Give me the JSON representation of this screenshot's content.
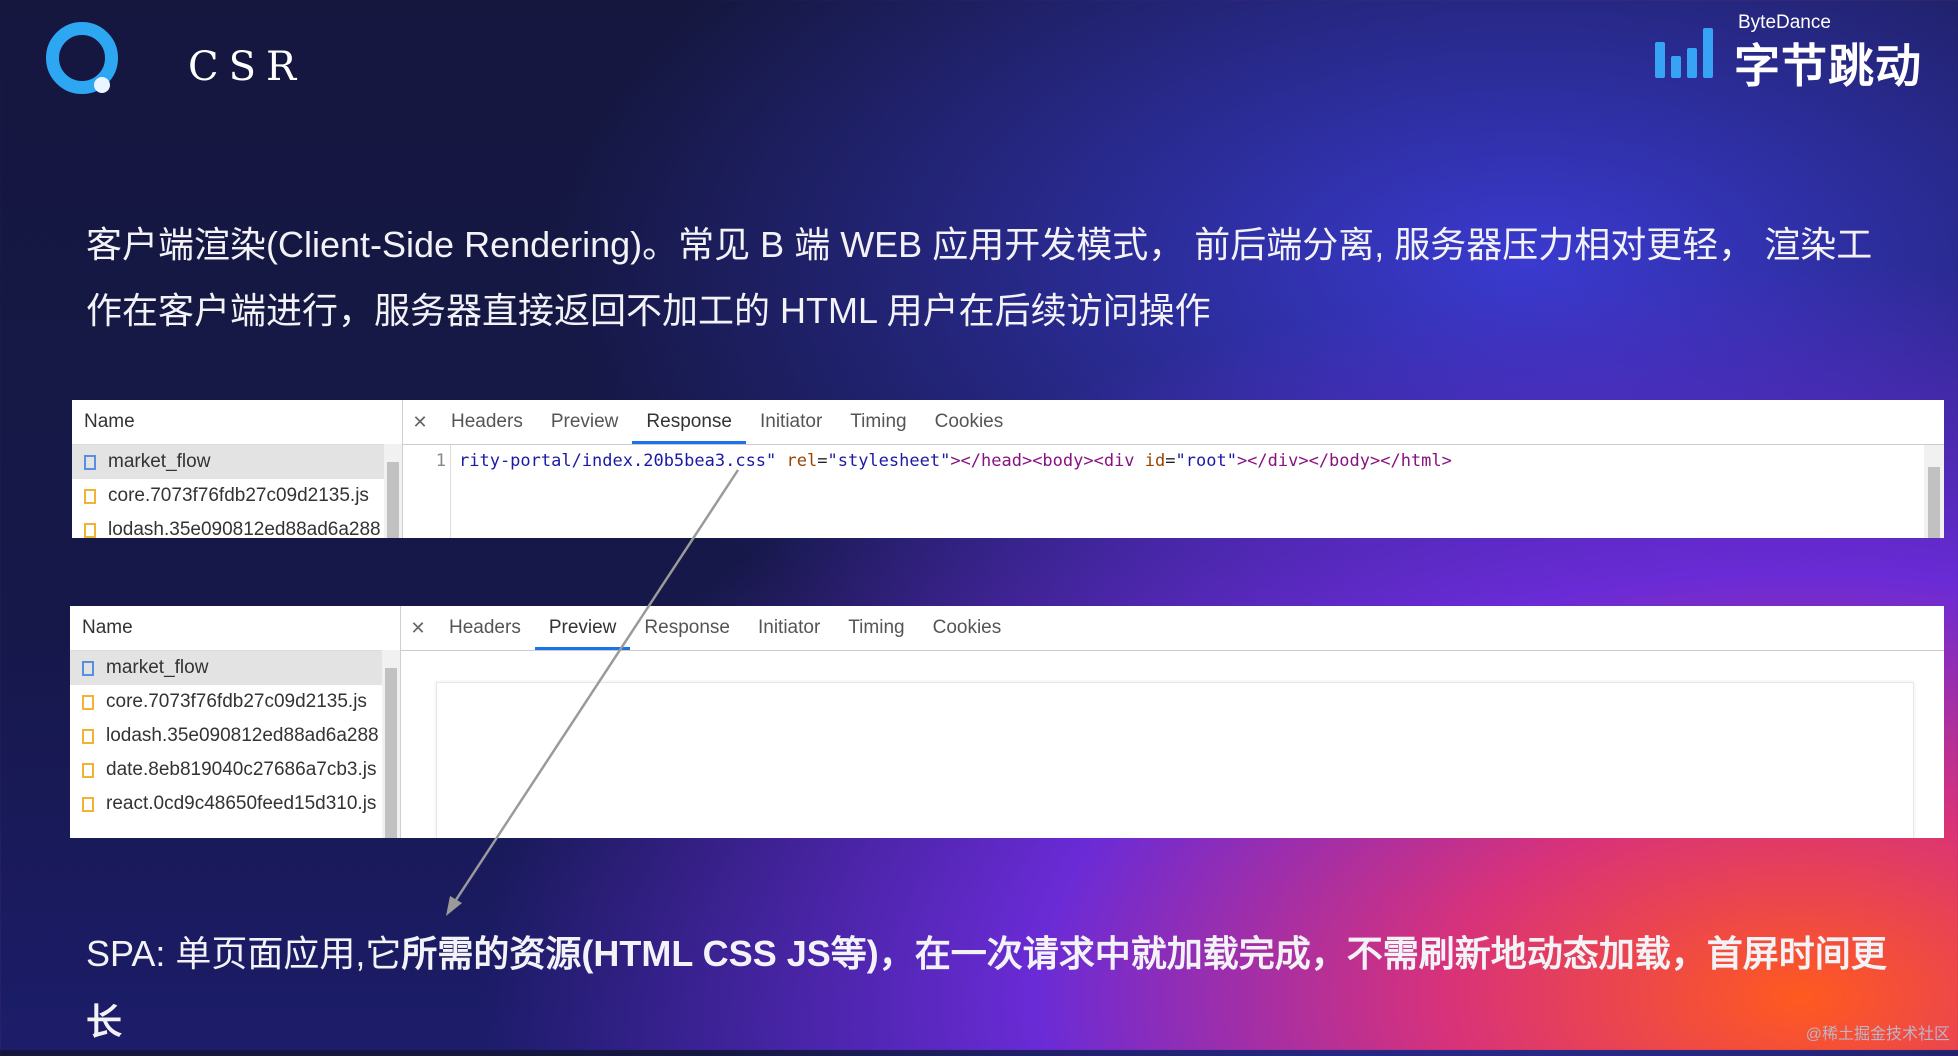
{
  "header": {
    "title": "CSR",
    "brand_small": "ByteDance",
    "brand_big": "字节跳动"
  },
  "paragraph1": "客户端渲染(Client-Side Rendering)。常见 B 端 WEB 应用开发模式， 前后端分离, 服务器压力相对更轻， 渲染工作在客户端进行，服务器直接返回不加工的 HTML 用户在后续访问操作",
  "devtools1": {
    "name_header": "Name",
    "files": [
      "market_flow",
      "core.7073f76fdb27c09d2135.js",
      "lodash.35e090812ed88ad6a288"
    ],
    "tabs": [
      "Headers",
      "Preview",
      "Response",
      "Initiator",
      "Timing",
      "Cookies"
    ],
    "active_tab": "Response",
    "line_number": "1",
    "code": {
      "p1": "rity-portal/index.20b5bea3.css\"",
      "p2": " rel",
      "p3": "=",
      "p4": "\"stylesheet\"",
      "p5": "></head><body><div",
      "p6": " id",
      "p7": "=",
      "p8": "\"root\"",
      "p9": "></div></body></html>"
    }
  },
  "devtools2": {
    "name_header": "Name",
    "files": [
      "market_flow",
      "core.7073f76fdb27c09d2135.js",
      "lodash.35e090812ed88ad6a288",
      "date.8eb819040c27686a7cb3.js",
      "react.0cd9c48650feed15d310.js"
    ],
    "tabs": [
      "Headers",
      "Preview",
      "Response",
      "Initiator",
      "Timing",
      "Cookies"
    ],
    "active_tab": "Preview"
  },
  "paragraph2": {
    "plain": "SPA: 单页面应用,它",
    "bold": "所需的资源(HTML CSS JS等)，在一次请求中就加载完成，不需刷新地动态加载，首屏时间更长"
  },
  "watermark": "@稀土掘金技术社区",
  "colors": {
    "accent_blue": "#2ea7f2",
    "tab_active": "#1a73e8"
  }
}
